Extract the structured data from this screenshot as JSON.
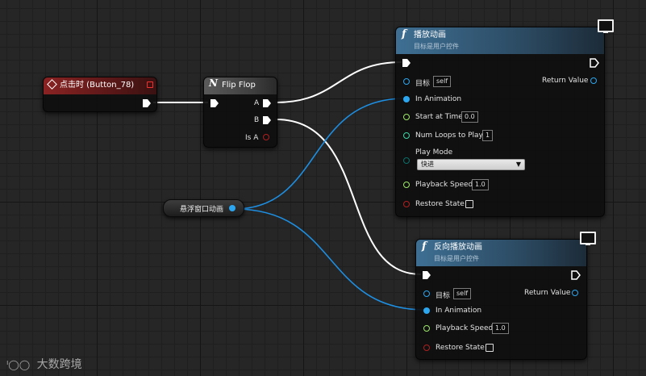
{
  "event_node": {
    "title": "点击时 (Button_78)"
  },
  "flipflop_node": {
    "title": "Flip Flop",
    "outputs": {
      "a": "A",
      "b": "B",
      "is_a": "Is A"
    }
  },
  "variable_node": {
    "label": "悬浮窗口动画"
  },
  "play_node": {
    "title": "播放动画",
    "subtitle": "目标是用户控件",
    "target_label": "目标",
    "target_value": "self",
    "return_label": "Return Value",
    "in_animation_label": "In Animation",
    "start_at_time_label": "Start at Time",
    "start_at_time_value": "0.0",
    "num_loops_label": "Num Loops to Play",
    "num_loops_value": "1",
    "play_mode_label": "Play Mode",
    "play_mode_value": "快进",
    "playback_speed_label": "Playback Speed",
    "playback_speed_value": "1.0",
    "restore_state_label": "Restore State"
  },
  "reverse_node": {
    "title": "反向播放动画",
    "subtitle": "目标是用户控件",
    "target_label": "目标",
    "target_value": "self",
    "return_label": "Return Value",
    "in_animation_label": "In Animation",
    "playback_speed_label": "Playback Speed",
    "playback_speed_value": "1.0",
    "restore_state_label": "Restore State"
  },
  "watermark": {
    "text": "大数跨境"
  },
  "colors": {
    "exec_wire": "#ffffff",
    "object_wire": "#1e8ee0",
    "float_pin": "#9ee86b",
    "int_pin": "#3fd6a6",
    "enum_pin": "#0a6f6a",
    "bool_pin": "#9a1a1a",
    "object_pin": "#2da6f0"
  }
}
